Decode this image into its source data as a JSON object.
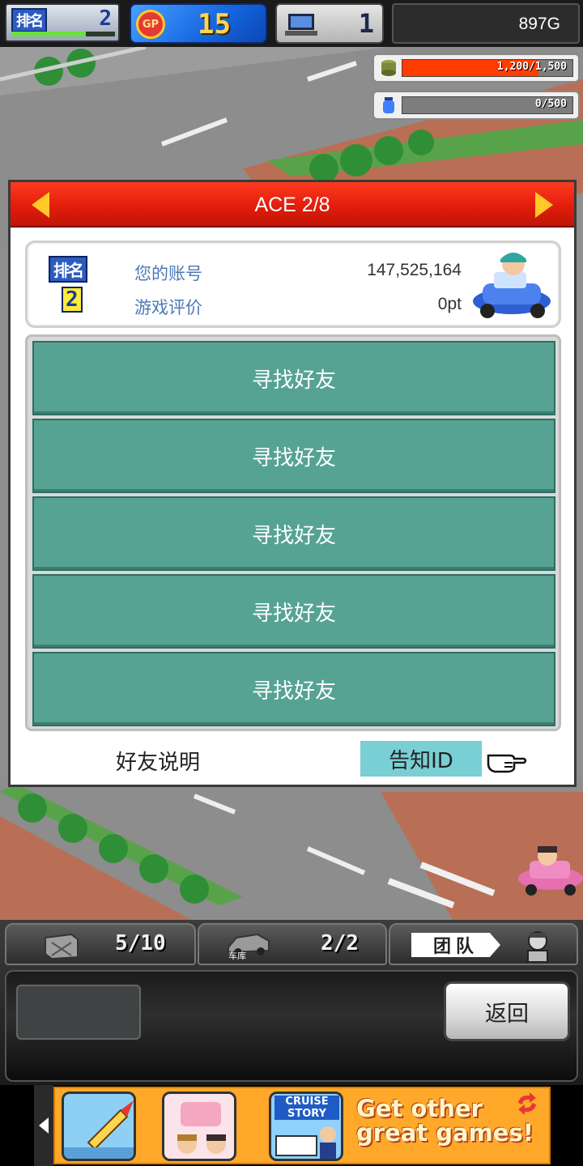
{
  "topbar": {
    "rank_label": "排名",
    "rank_value": "2",
    "rank_progress": 0.72,
    "gp_label": "GP",
    "gp_value": "15",
    "pc_value": "1",
    "gold": "897G"
  },
  "meters": {
    "money": {
      "text": "1,200/1,500",
      "fraction": 0.8,
      "color": "#ff3d00"
    },
    "fuel": {
      "text": "0/500",
      "fraction": 0.0,
      "color": "#3f7fff"
    }
  },
  "dialog": {
    "title": "ACE 2/8",
    "rank_label": "排名",
    "rank_value": "2",
    "account_label": "您的账号",
    "account_value": "147,525,164",
    "rating_label": "游戏评价",
    "rating_value": "0pt",
    "friend_slots": [
      "寻找好友",
      "寻找好友",
      "寻找好友",
      "寻找好友",
      "寻找好友"
    ],
    "help_link": "好友说明",
    "notify_button": "告知ID"
  },
  "hud": {
    "parts_count": "5/10",
    "garage_count": "2/2",
    "garage_label": "车库",
    "team_label": "团队",
    "back_button": "返回"
  },
  "ad": {
    "game_1": "",
    "game_2": "",
    "game_3": "CRUISE STORY",
    "slogan_line1": "Get other",
    "slogan_line2": "great games!"
  }
}
